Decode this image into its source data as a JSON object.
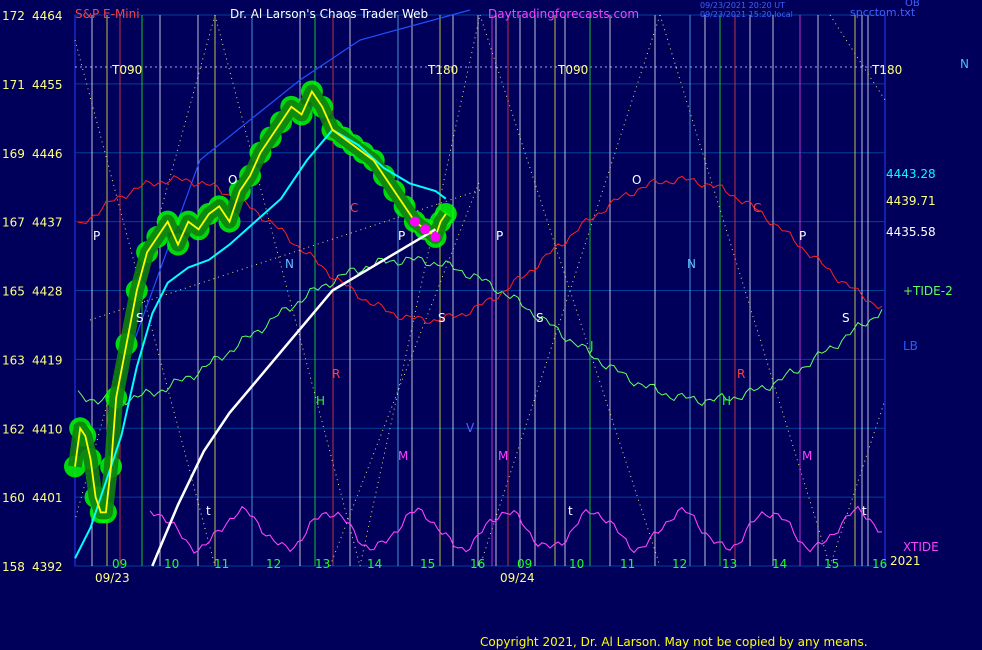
{
  "header": {
    "instrument": "S&P E-Mini",
    "title": "Dr. Al Larson's Chaos Trader Web",
    "site": "Daytradingforecasts.com",
    "stamp_line1": "09/23/2021 20:20 UT",
    "stamp_line2": "09/23/2021 15:20 local",
    "corner_label": "spcctom.txt",
    "corner_label_top": "OB",
    "n_marker": "N"
  },
  "footer": {
    "copyright": "Copyright 2021, Dr. Al Larson. May not be copied by any means."
  },
  "colors": {
    "background": "#00005a",
    "price": "#ffff00",
    "moving_average": "#00ffff",
    "forecast": "#ffffff",
    "highlight": "#00ff00",
    "peak_marker": "#ff00ff",
    "xtide": "#ff40ff",
    "tide": "#60ff60",
    "red_wave": "#ff2020"
  },
  "chart_data": {
    "type": "line",
    "y_left_labels": [
      {
        "index": "172",
        "price": "4464"
      },
      {
        "index": "171",
        "price": "4455"
      },
      {
        "index": "169",
        "price": "4446"
      },
      {
        "index": "167",
        "price": "4437"
      },
      {
        "index": "165",
        "price": "4428"
      },
      {
        "index": "163",
        "price": "4419"
      },
      {
        "index": "162",
        "price": "4410"
      },
      {
        "index": "160",
        "price": "4401"
      },
      {
        "index": "158",
        "price": "4392"
      }
    ],
    "ylim": [
      4392,
      4464
    ],
    "x_hour_labels": [
      "09",
      "10",
      "11",
      "12",
      "13",
      "14",
      "15",
      "16",
      "09",
      "10",
      "11",
      "12",
      "13",
      "14",
      "15",
      "16"
    ],
    "x_date_labels": [
      "09/23",
      "09/24"
    ],
    "year_label": "2021",
    "right_values": [
      "4443.28",
      "4439.71",
      "4435.58"
    ],
    "right_series_labels": [
      "+TIDE-2",
      "LB",
      "XTIDE"
    ],
    "top_markers": [
      "T090",
      "T180",
      "T090",
      "T180"
    ],
    "cycle_letters": [
      "P",
      "O",
      "N",
      "C",
      "P",
      "S",
      "R",
      "H",
      "M",
      "V",
      "S",
      "P",
      "J",
      "M",
      "O",
      "N",
      "C",
      "P",
      "S",
      "R",
      "H",
      "M",
      "t",
      "t",
      "t",
      "S"
    ],
    "series": [
      {
        "name": "S&P E-Mini",
        "x": [
          0.0,
          0.1,
          0.2,
          0.3,
          0.4,
          0.5,
          0.6,
          0.7,
          0.8,
          1.0,
          1.2,
          1.4,
          1.6,
          1.8,
          2.0,
          2.2,
          2.4,
          2.6,
          2.8,
          3.0,
          3.2,
          3.4,
          3.6,
          3.8,
          4.0,
          4.2,
          4.4,
          4.6,
          4.8,
          5.0,
          5.2,
          5.4,
          5.6,
          5.8,
          6.0,
          6.2,
          6.4,
          6.6,
          6.8,
          7.0,
          7.1,
          7.2
        ],
        "values": [
          4405,
          4410,
          4409,
          4406,
          4401,
          4399,
          4399,
          4405,
          4414,
          4421,
          4428,
          4433,
          4435,
          4437,
          4434,
          4437,
          4436,
          4438,
          4439,
          4437,
          4441,
          4443,
          4446,
          4448,
          4450,
          4452,
          4451,
          4454,
          4452,
          4449,
          4448,
          4447,
          4446,
          4445,
          4443,
          4441,
          4439,
          4437,
          4436,
          4435,
          4437,
          4438
        ]
      },
      {
        "name": "Average",
        "x": [
          0.0,
          0.3,
          0.6,
          0.9,
          1.2,
          1.5,
          1.8,
          2.2,
          2.6,
          3.0,
          3.5,
          4.0,
          4.5,
          5.0,
          5.5,
          6.0,
          6.5,
          7.0,
          7.2
        ],
        "values": [
          4393,
          4397,
          4403,
          4409,
          4418,
          4425,
          4429,
          4431,
          4432,
          4434,
          4437,
          4440,
          4445,
          4449,
          4447,
          4444,
          4442,
          4441,
          4440
        ]
      },
      {
        "name": "Forecast",
        "x": [
          1.5,
          2.0,
          2.5,
          3.0,
          3.5,
          4.0,
          4.5,
          5.0,
          5.5,
          6.0,
          6.5,
          7.0
        ],
        "values": [
          4392,
          4400,
          4407,
          4412,
          4416,
          4420,
          4424,
          4428,
          4430,
          4432,
          4434,
          4436
        ]
      }
    ]
  }
}
